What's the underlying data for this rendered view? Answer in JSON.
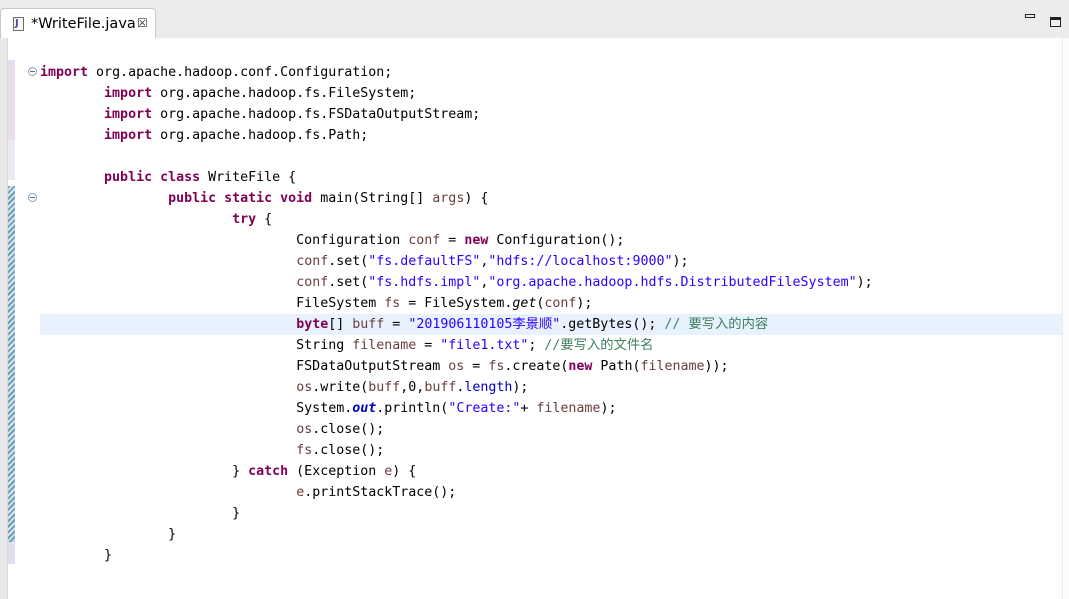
{
  "tab": {
    "title": "*WriteFile.java",
    "icon": "java-file-icon",
    "icon_letter": "J",
    "close_glyph": "☒"
  },
  "window_controls": [
    "minimize-icon",
    "maximize-icon"
  ],
  "editor": {
    "current_line": 13,
    "lines": [
      [
        {
          "t": "import",
          "c": "kw"
        },
        {
          "t": " org.apache.hadoop.conf.Configuration;",
          "c": ""
        }
      ],
      [
        {
          "t": "        ",
          "c": ""
        },
        {
          "t": "import",
          "c": "kw"
        },
        {
          "t": " org.apache.hadoop.fs.FileSystem;",
          "c": ""
        }
      ],
      [
        {
          "t": "        ",
          "c": ""
        },
        {
          "t": "import",
          "c": "kw"
        },
        {
          "t": " org.apache.hadoop.fs.FSDataOutputStream;",
          "c": ""
        }
      ],
      [
        {
          "t": "        ",
          "c": ""
        },
        {
          "t": "import",
          "c": "kw"
        },
        {
          "t": " org.apache.hadoop.fs.Path;",
          "c": ""
        }
      ],
      [
        {
          "t": "",
          "c": ""
        }
      ],
      [
        {
          "t": "        ",
          "c": ""
        },
        {
          "t": "public class",
          "c": "kw"
        },
        {
          "t": " WriteFile {",
          "c": ""
        }
      ],
      [
        {
          "t": "                ",
          "c": ""
        },
        {
          "t": "public static void",
          "c": "kw"
        },
        {
          "t": " main(String[] ",
          "c": ""
        },
        {
          "t": "args",
          "c": "var"
        },
        {
          "t": ") {",
          "c": ""
        }
      ],
      [
        {
          "t": "                        ",
          "c": ""
        },
        {
          "t": "try",
          "c": "kw"
        },
        {
          "t": " {",
          "c": ""
        }
      ],
      [
        {
          "t": "                                Configuration ",
          "c": ""
        },
        {
          "t": "conf",
          "c": "var"
        },
        {
          "t": " = ",
          "c": ""
        },
        {
          "t": "new",
          "c": "kw"
        },
        {
          "t": " Configuration();",
          "c": ""
        }
      ],
      [
        {
          "t": "                                ",
          "c": ""
        },
        {
          "t": "conf",
          "c": "var"
        },
        {
          "t": ".set(",
          "c": ""
        },
        {
          "t": "\"fs.defaultFS\"",
          "c": "str"
        },
        {
          "t": ",",
          "c": ""
        },
        {
          "t": "\"hdfs://localhost:9000\"",
          "c": "str"
        },
        {
          "t": ");",
          "c": ""
        }
      ],
      [
        {
          "t": "                                ",
          "c": ""
        },
        {
          "t": "conf",
          "c": "var"
        },
        {
          "t": ".set(",
          "c": ""
        },
        {
          "t": "\"fs.hdfs.impl\"",
          "c": "str"
        },
        {
          "t": ",",
          "c": ""
        },
        {
          "t": "\"org.apache.hadoop.hdfs.DistributedFileSystem\"",
          "c": "str"
        },
        {
          "t": ");",
          "c": ""
        }
      ],
      [
        {
          "t": "                                FileSystem ",
          "c": ""
        },
        {
          "t": "fs",
          "c": "var"
        },
        {
          "t": " = FileSystem.",
          "c": ""
        },
        {
          "t": "get",
          "c": "static-method"
        },
        {
          "t": "(",
          "c": ""
        },
        {
          "t": "conf",
          "c": "var"
        },
        {
          "t": ");",
          "c": ""
        }
      ],
      [
        {
          "t": "                                ",
          "c": ""
        },
        {
          "t": "byte",
          "c": "kw"
        },
        {
          "t": "[] ",
          "c": ""
        },
        {
          "t": "buff",
          "c": "var"
        },
        {
          "t": " = ",
          "c": ""
        },
        {
          "t": "\"201906110105李景顺\"",
          "c": "str"
        },
        {
          "t": ".getBytes(); ",
          "c": ""
        },
        {
          "t": "// 要写入的内容",
          "c": "cmt"
        }
      ],
      [
        {
          "t": "                                String ",
          "c": ""
        },
        {
          "t": "filename",
          "c": "var"
        },
        {
          "t": " = ",
          "c": ""
        },
        {
          "t": "\"file1.txt\"",
          "c": "str"
        },
        {
          "t": "; ",
          "c": ""
        },
        {
          "t": "//要写入的文件名",
          "c": "cmt"
        }
      ],
      [
        {
          "t": "                                FSDataOutputStream ",
          "c": ""
        },
        {
          "t": "os",
          "c": "var"
        },
        {
          "t": " = ",
          "c": ""
        },
        {
          "t": "fs",
          "c": "var"
        },
        {
          "t": ".create(",
          "c": ""
        },
        {
          "t": "new",
          "c": "kw"
        },
        {
          "t": " Path(",
          "c": ""
        },
        {
          "t": "filename",
          "c": "var"
        },
        {
          "t": "));",
          "c": ""
        }
      ],
      [
        {
          "t": "                                ",
          "c": ""
        },
        {
          "t": "os",
          "c": "var"
        },
        {
          "t": ".write(",
          "c": ""
        },
        {
          "t": "buff",
          "c": "var"
        },
        {
          "t": ",0,",
          "c": ""
        },
        {
          "t": "buff",
          "c": "var"
        },
        {
          "t": ".",
          "c": ""
        },
        {
          "t": "length",
          "c": "field"
        },
        {
          "t": ");",
          "c": ""
        }
      ],
      [
        {
          "t": "                                System.",
          "c": ""
        },
        {
          "t": "out",
          "c": "static-field"
        },
        {
          "t": ".println(",
          "c": ""
        },
        {
          "t": "\"Create:\"",
          "c": "str"
        },
        {
          "t": "+ ",
          "c": ""
        },
        {
          "t": "filename",
          "c": "var"
        },
        {
          "t": ");",
          "c": ""
        }
      ],
      [
        {
          "t": "                                ",
          "c": ""
        },
        {
          "t": "os",
          "c": "var"
        },
        {
          "t": ".close();",
          "c": ""
        }
      ],
      [
        {
          "t": "                                ",
          "c": ""
        },
        {
          "t": "fs",
          "c": "var"
        },
        {
          "t": ".close();",
          "c": ""
        }
      ],
      [
        {
          "t": "                        } ",
          "c": ""
        },
        {
          "t": "catch",
          "c": "kw"
        },
        {
          "t": " (Exception ",
          "c": ""
        },
        {
          "t": "e",
          "c": "var"
        },
        {
          "t": ") {",
          "c": ""
        }
      ],
      [
        {
          "t": "                                ",
          "c": ""
        },
        {
          "t": "e",
          "c": "var"
        },
        {
          "t": ".printStackTrace();",
          "c": ""
        }
      ],
      [
        {
          "t": "                        }",
          "c": ""
        }
      ],
      [
        {
          "t": "                }",
          "c": ""
        }
      ],
      [
        {
          "t": "        }",
          "c": ""
        }
      ]
    ]
  },
  "colors": {
    "keyword": "#7f0055",
    "string": "#2a00ff",
    "local_variable": "#6a3e3e",
    "comment": "#3f7f5f",
    "field": "#0000c0",
    "current_line_bg": "#e8f2fe",
    "change_marker": "#6f9fb7"
  }
}
